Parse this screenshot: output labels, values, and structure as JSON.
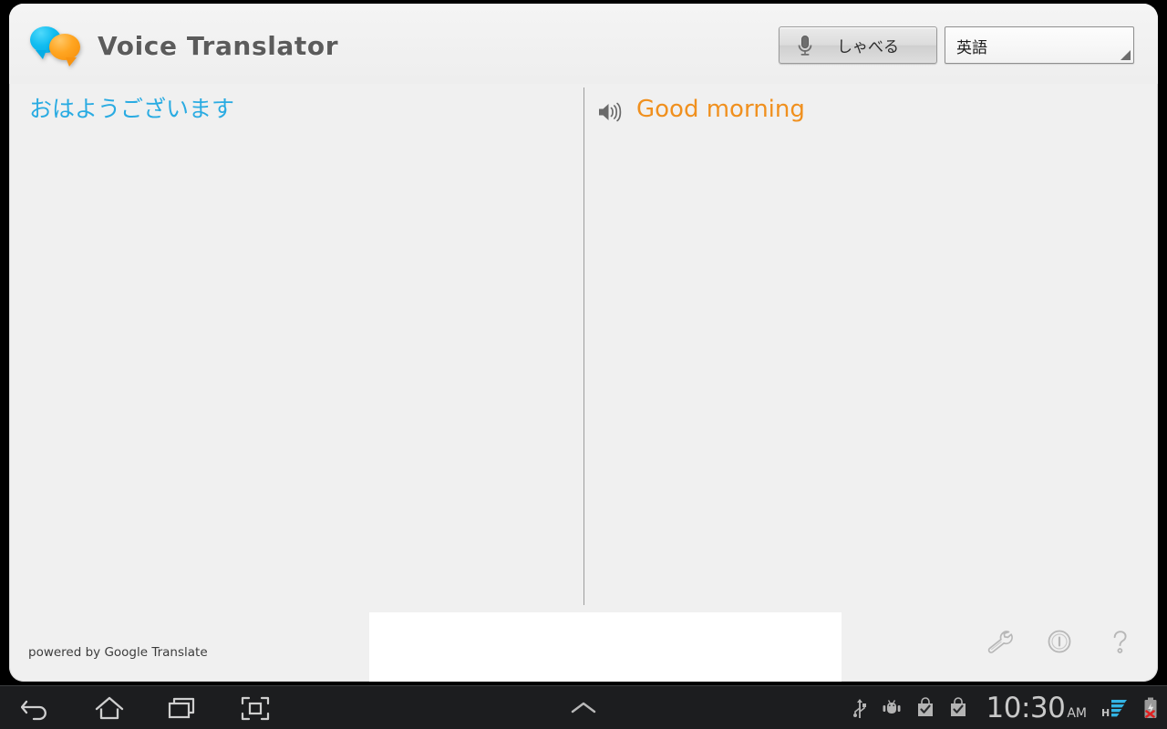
{
  "app": {
    "title": "Voice Translator",
    "logo_icon": "speech-bubbles-icon",
    "logo_bubble_colors": {
      "left": "#12bdf0",
      "right": "#ffa521"
    }
  },
  "header": {
    "speak_button": {
      "label": "しゃべる",
      "icon": "microphone-icon"
    },
    "language_spinner": {
      "value": "英語",
      "corner_icon": "spinner-corner-triangle-icon"
    }
  },
  "panels": {
    "source": {
      "text": "おはようございます",
      "color": "#29abe2"
    },
    "target": {
      "text": "Good morning",
      "color": "#f0901e",
      "speaker_icon": "speaker-volume-icon"
    }
  },
  "footer": {
    "powered_by": "powered by Google Translate",
    "tools": [
      {
        "name": "wrench-icon",
        "label": "Settings"
      },
      {
        "name": "info-circle-icon",
        "label": "Info"
      },
      {
        "name": "question-mark-icon",
        "label": "Help"
      }
    ]
  },
  "system_bar": {
    "nav": [
      {
        "name": "back-icon",
        "label": "Back"
      },
      {
        "name": "home-icon",
        "label": "Home"
      },
      {
        "name": "recent-apps-icon",
        "label": "Recent apps"
      },
      {
        "name": "screenshot-icon",
        "label": "Screenshot"
      }
    ],
    "notification_chevron": "chevron-up-icon",
    "status": {
      "usb_icon": "usb-icon",
      "debug_icon": "android-debug-icon",
      "download_icon_1": "play-store-bag-check-icon",
      "download_icon_2": "play-store-bag-check-icon",
      "clock": "10:30",
      "meridiem": "AM",
      "network_type": "H",
      "signal_icon": "signal-bars-icon",
      "signal_color": "#33b5e5",
      "battery_icon": "battery-error-icon",
      "battery_error_color": "#e02020"
    }
  }
}
